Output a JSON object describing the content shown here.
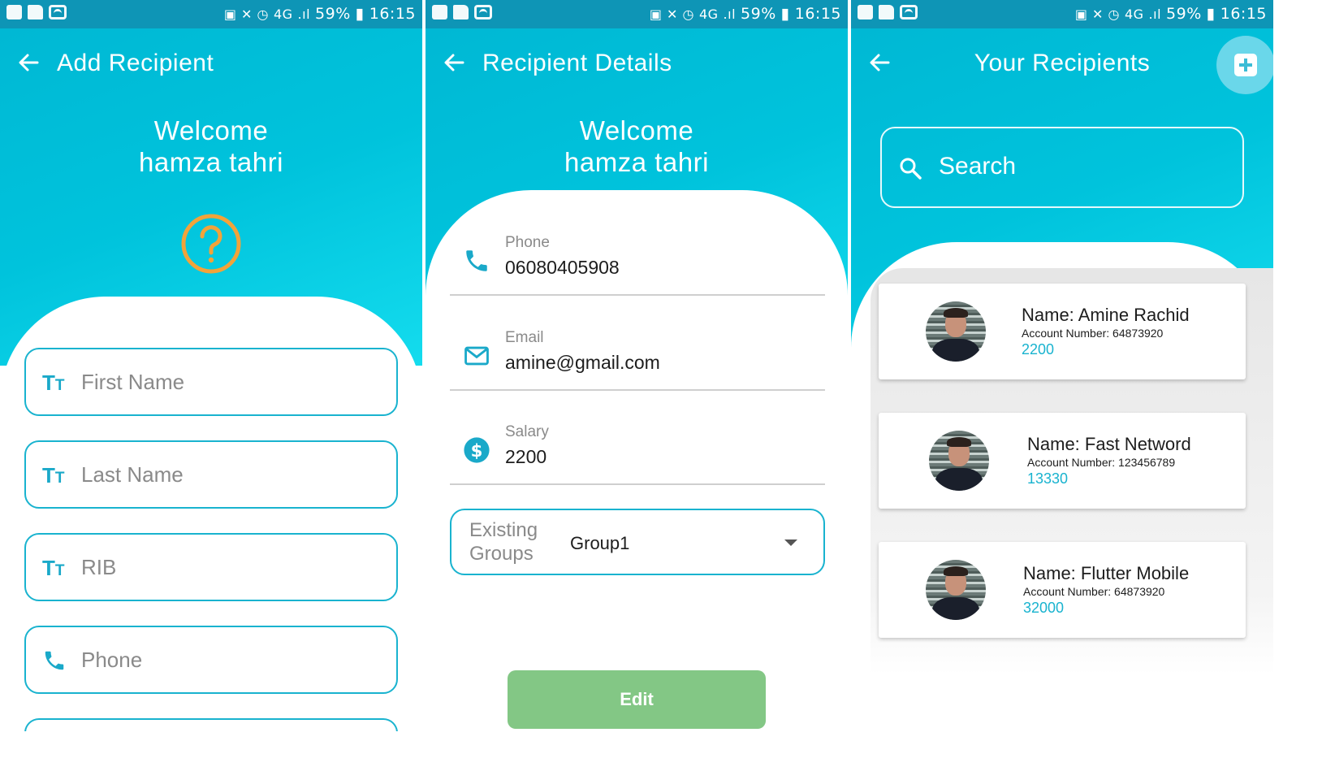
{
  "status_bar": {
    "battery": "59%",
    "time": "16:15",
    "network": "4G"
  },
  "colors": {
    "accent": "#00bcd4",
    "accent_dark": "#0e95b6",
    "icon_blue": "#1aa9c9",
    "question_orange": "#f2a33a",
    "edit_button": "#83c785",
    "amount_blue": "#19b3cf"
  },
  "add_screen": {
    "title": "Add Recipient",
    "welcome_line1": "Welcome",
    "welcome_line2": "hamza tahri",
    "icon": "help-circle-icon",
    "fields": [
      {
        "icon": "text-fields-icon",
        "placeholder": "First Name"
      },
      {
        "icon": "text-fields-icon",
        "placeholder": "Last Name"
      },
      {
        "icon": "text-fields-icon",
        "placeholder": "RIB"
      },
      {
        "icon": "phone-icon",
        "placeholder": "Phone"
      }
    ]
  },
  "details_screen": {
    "title": "Recipient Details",
    "welcome_line1": "Welcome",
    "welcome_line2": "hamza tahri",
    "rows": [
      {
        "icon": "phone-icon",
        "label": "Phone",
        "value": "06080405908"
      },
      {
        "icon": "email-icon",
        "label": "Email",
        "value": "amine@gmail.com"
      },
      {
        "icon": "dollar-icon",
        "label": "Salary",
        "value": "2200"
      }
    ],
    "dropdown": {
      "label": "Existing Groups",
      "value": "Group1"
    },
    "edit_label": "Edit"
  },
  "list_screen": {
    "title": "Your Recipients",
    "search_placeholder": "Search",
    "recipients": [
      {
        "name": "Name: Amine Rachid",
        "account": "Account Number: 64873920",
        "amount": "2200"
      },
      {
        "name": "Name: Fast Netword",
        "account": "Account Number: 123456789",
        "amount": "13330"
      },
      {
        "name": "Name: Flutter Mobile",
        "account": "Account Number: 64873920",
        "amount": "32000"
      }
    ]
  }
}
